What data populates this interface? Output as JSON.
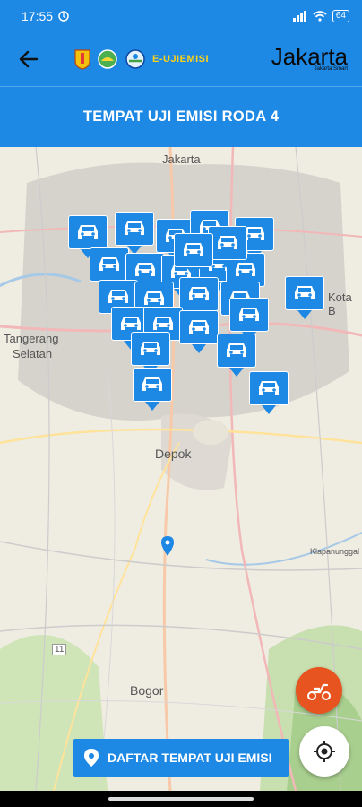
{
  "status_bar": {
    "time": "17:55",
    "battery": "64"
  },
  "app_bar": {
    "brand_text": "E-UJIEMISI",
    "city_logo_text": "Jakarta",
    "city_logo_subtext": "Jakarta Smart"
  },
  "title": "TEMPAT UJI EMISI RODA 4",
  "map": {
    "labels": {
      "jakarta": "Jakarta",
      "kota_bekasi": "Kota B",
      "tangerang_selatan_1": "Tangerang",
      "tangerang_selatan_2": "Selatan",
      "depok": "Depok",
      "bogor": "Bogor",
      "klapanunggal": "Klapanunggal",
      "road_11": "11"
    }
  },
  "list_button_label": "DAFTAR TEMPAT UJI EMISI",
  "icons": {
    "back": "arrow-left-icon",
    "scooter": "scooter-icon",
    "locate": "my-location-icon",
    "pin": "location-pin-icon",
    "car": "car-icon"
  },
  "colors": {
    "primary": "#1e88e5",
    "accent_orange": "#e8541f",
    "brand_yellow": "#ffd21a"
  }
}
